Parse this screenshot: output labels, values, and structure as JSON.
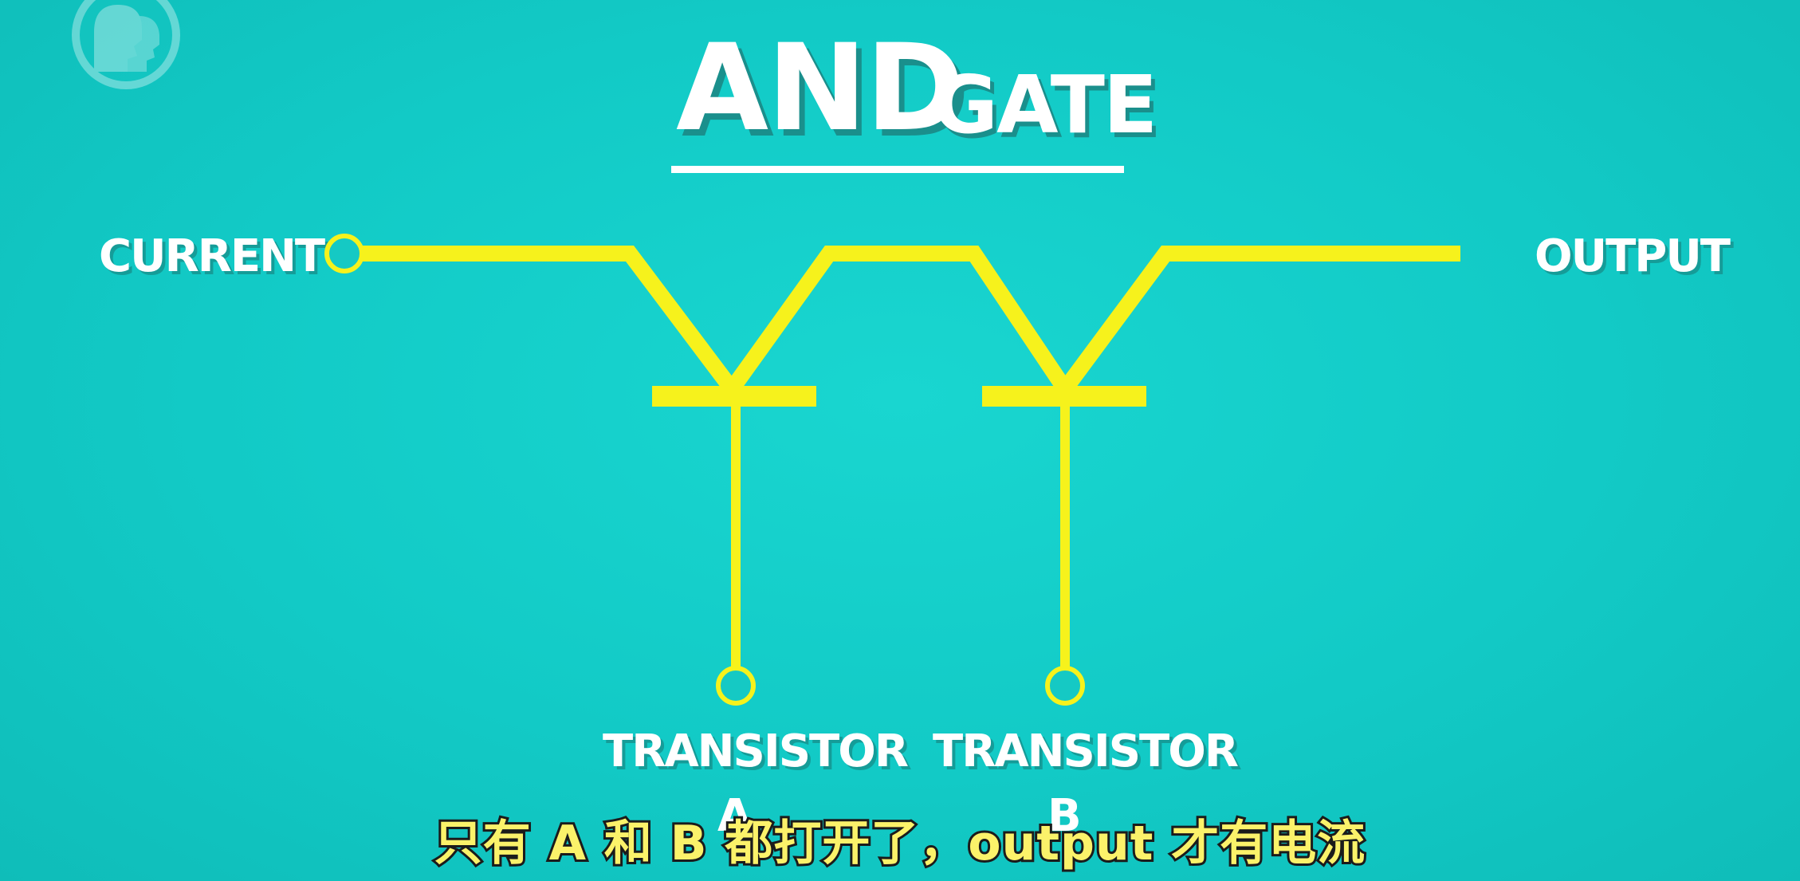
{
  "logo": {
    "icon": "pbs-logo-icon"
  },
  "title": {
    "main": "AND",
    "suffix": "GATE"
  },
  "labels": {
    "current": "CURRENT",
    "output": "OUTPUT",
    "transistor_a": "TRANSISTOR",
    "transistor_a_letter": "A",
    "transistor_b": "TRANSISTOR",
    "transistor_b_letter": "B"
  },
  "subtitle": "只有 A 和 B 都打开了，output 才有电流",
  "colors": {
    "background": "#12cac6",
    "wire": "#f6f21c",
    "text": "#ffffff",
    "subtitle": "#fbf26a"
  }
}
